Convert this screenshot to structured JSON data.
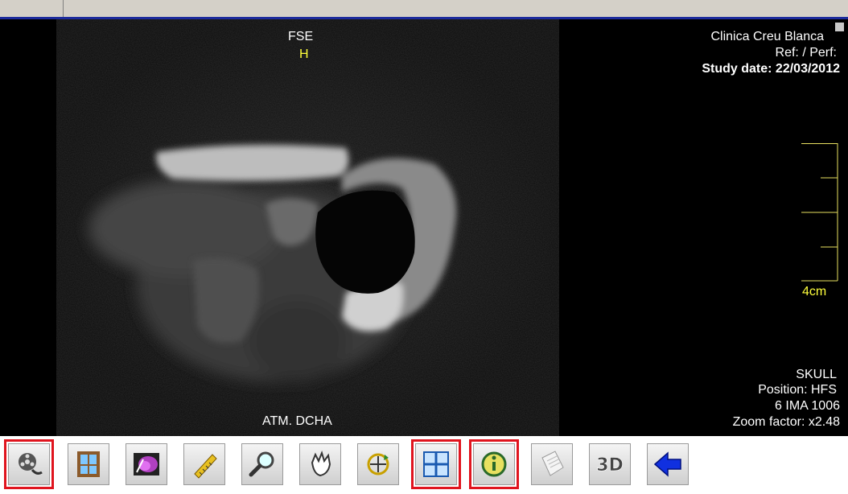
{
  "overlay": {
    "top_center": {
      "sequence": "FSE",
      "orientation": "H"
    },
    "top_right": {
      "institution": "Clinica Creu Blanca",
      "ref": "Ref:  / Perf:",
      "study_date": "Study date: 22/03/2012"
    },
    "scale_label": "4cm",
    "bottom_center": "ATM. DCHA",
    "bottom_right": {
      "body_part": "SKULL",
      "position": "Position: HFS",
      "image": "6 IMA 1006",
      "zoom": "Zoom factor: x2.48"
    }
  },
  "colors": {
    "accent_border": "#1c2a9c",
    "overlay_text": "#ffffff",
    "orientation_text": "#ffff3c",
    "selected_tool": "#e0141e"
  },
  "toolbar": {
    "buttons": [
      {
        "name": "cine-button",
        "icon": "film-reel-icon",
        "selected": true
      },
      {
        "name": "window-level-button",
        "icon": "window-icon",
        "selected": false
      },
      {
        "name": "color-map-button",
        "icon": "color-brain-icon",
        "selected": false
      },
      {
        "name": "measure-button",
        "icon": "ruler-icon",
        "selected": false
      },
      {
        "name": "zoom-button",
        "icon": "magnifier-icon",
        "selected": false
      },
      {
        "name": "pan-button",
        "icon": "hand-icon",
        "selected": false
      },
      {
        "name": "rotate-button",
        "icon": "rotate-icon",
        "selected": false
      },
      {
        "name": "layout-button",
        "icon": "grid-icon",
        "selected": true
      },
      {
        "name": "info-button",
        "icon": "info-icon",
        "selected": true
      },
      {
        "name": "report-button",
        "icon": "document-icon",
        "selected": false
      },
      {
        "name": "3d-button",
        "icon": "3d-icon",
        "selected": false
      },
      {
        "name": "back-button",
        "icon": "arrow-left-icon",
        "selected": false
      }
    ]
  }
}
